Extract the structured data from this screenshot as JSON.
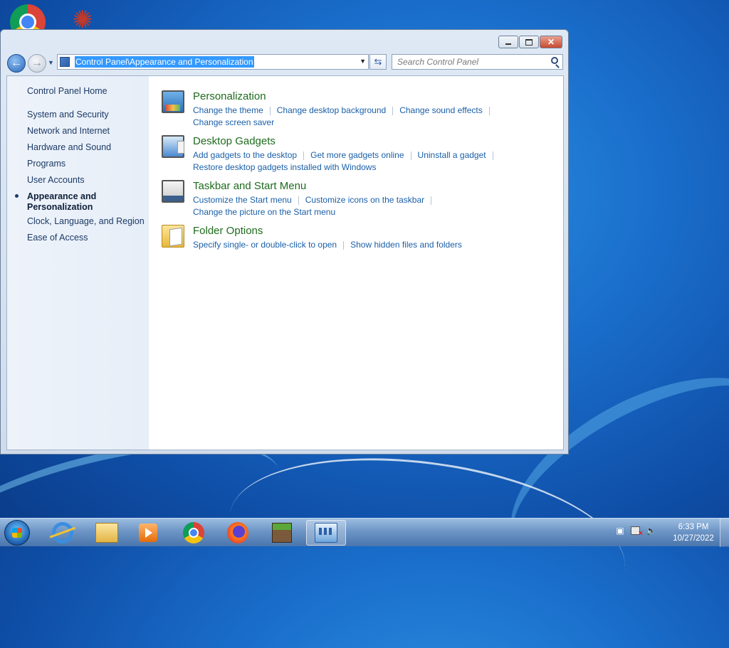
{
  "window": {
    "address_path": "Control Panel\\Appearance and Personalization",
    "search_placeholder": "Search Control Panel"
  },
  "left_nav": {
    "home": "Control Panel Home",
    "items": [
      "System and Security",
      "Network and Internet",
      "Hardware and Sound",
      "Programs",
      "User Accounts"
    ],
    "current_line1": "Appearance and",
    "current_line2": "Personalization",
    "after_items": [
      "Clock, Language, and Region",
      "Ease of Access"
    ]
  },
  "sections": [
    {
      "title": "Personalization",
      "icon": "personalization-icon",
      "links": [
        "Change the theme",
        "Change desktop background",
        "Change sound effects",
        "Change screen saver"
      ]
    },
    {
      "title": "Desktop Gadgets",
      "icon": "desktop-gadgets-icon",
      "links": [
        "Add gadgets to the desktop",
        "Get more gadgets online",
        "Uninstall a gadget",
        "Restore desktop gadgets installed with Windows"
      ]
    },
    {
      "title": "Taskbar and Start Menu",
      "icon": "taskbar-icon",
      "links": [
        "Customize the Start menu",
        "Customize icons on the taskbar",
        "Change the picture on the Start menu"
      ]
    },
    {
      "title": "Folder Options",
      "icon": "folder-options-icon",
      "links": [
        "Specify single- or double-click to open",
        "Show hidden files and folders"
      ]
    }
  ],
  "taskbar": {
    "apps": [
      "internet-explorer",
      "windows-explorer",
      "media-player",
      "google-chrome",
      "firefox",
      "minecraft",
      "control-panel"
    ],
    "active_app": "control-panel",
    "clock_time": "6:33 PM",
    "clock_date": "10/27/2022"
  }
}
